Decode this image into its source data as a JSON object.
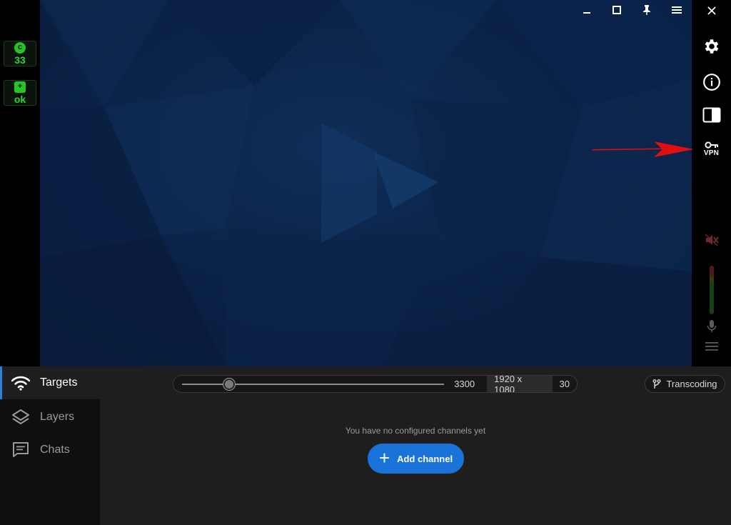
{
  "status": {
    "cpu": {
      "icon": "cpu-icon",
      "symbol": "c",
      "value": "33"
    },
    "health": {
      "icon": "health-icon",
      "symbol": "+",
      "value": "ok"
    }
  },
  "window_controls": {
    "icons": [
      "minimize-icon",
      "maximize-icon",
      "pin-icon",
      "menu-icon",
      "close-icon"
    ]
  },
  "toolbar": {
    "items": [
      "settings-icon",
      "info-icon",
      "layout-toggle-icon",
      "vpn-key-icon",
      "speaker-muted-icon",
      "microphone-icon",
      "hamburger-icon"
    ],
    "vpn_label": "VPN"
  },
  "nav": {
    "items": [
      {
        "label": "Targets",
        "icon": "wifi-icon",
        "active": true
      },
      {
        "label": "Layers",
        "icon": "layers-icon",
        "active": false
      },
      {
        "label": "Chats",
        "icon": "chat-icon",
        "active": false
      }
    ]
  },
  "quality": {
    "bitrate": "3300",
    "resolution": "1920 x 1080",
    "fps": "30",
    "slider_fraction": 0.18
  },
  "transcoding": {
    "label": "Transcoding",
    "icon": "branch-icon"
  },
  "channels": {
    "empty_message": "You have no configured channels yet",
    "add_label": "Add channel"
  },
  "colors": {
    "accent": "#1a73d9",
    "status_green": "#2fd32f",
    "annotation_red": "#e01010",
    "preview_bg": "#0b2348"
  }
}
